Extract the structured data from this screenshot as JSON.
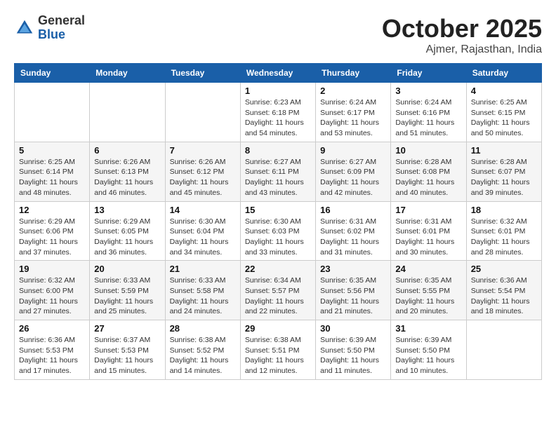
{
  "header": {
    "logo_general": "General",
    "logo_blue": "Blue",
    "month_title": "October 2025",
    "location": "Ajmer, Rajasthan, India"
  },
  "weekdays": [
    "Sunday",
    "Monday",
    "Tuesday",
    "Wednesday",
    "Thursday",
    "Friday",
    "Saturday"
  ],
  "weeks": [
    [
      {
        "day": "",
        "info": ""
      },
      {
        "day": "",
        "info": ""
      },
      {
        "day": "",
        "info": ""
      },
      {
        "day": "1",
        "info": "Sunrise: 6:23 AM\nSunset: 6:18 PM\nDaylight: 11 hours\nand 54 minutes."
      },
      {
        "day": "2",
        "info": "Sunrise: 6:24 AM\nSunset: 6:17 PM\nDaylight: 11 hours\nand 53 minutes."
      },
      {
        "day": "3",
        "info": "Sunrise: 6:24 AM\nSunset: 6:16 PM\nDaylight: 11 hours\nand 51 minutes."
      },
      {
        "day": "4",
        "info": "Sunrise: 6:25 AM\nSunset: 6:15 PM\nDaylight: 11 hours\nand 50 minutes."
      }
    ],
    [
      {
        "day": "5",
        "info": "Sunrise: 6:25 AM\nSunset: 6:14 PM\nDaylight: 11 hours\nand 48 minutes."
      },
      {
        "day": "6",
        "info": "Sunrise: 6:26 AM\nSunset: 6:13 PM\nDaylight: 11 hours\nand 46 minutes."
      },
      {
        "day": "7",
        "info": "Sunrise: 6:26 AM\nSunset: 6:12 PM\nDaylight: 11 hours\nand 45 minutes."
      },
      {
        "day": "8",
        "info": "Sunrise: 6:27 AM\nSunset: 6:11 PM\nDaylight: 11 hours\nand 43 minutes."
      },
      {
        "day": "9",
        "info": "Sunrise: 6:27 AM\nSunset: 6:09 PM\nDaylight: 11 hours\nand 42 minutes."
      },
      {
        "day": "10",
        "info": "Sunrise: 6:28 AM\nSunset: 6:08 PM\nDaylight: 11 hours\nand 40 minutes."
      },
      {
        "day": "11",
        "info": "Sunrise: 6:28 AM\nSunset: 6:07 PM\nDaylight: 11 hours\nand 39 minutes."
      }
    ],
    [
      {
        "day": "12",
        "info": "Sunrise: 6:29 AM\nSunset: 6:06 PM\nDaylight: 11 hours\nand 37 minutes."
      },
      {
        "day": "13",
        "info": "Sunrise: 6:29 AM\nSunset: 6:05 PM\nDaylight: 11 hours\nand 36 minutes."
      },
      {
        "day": "14",
        "info": "Sunrise: 6:30 AM\nSunset: 6:04 PM\nDaylight: 11 hours\nand 34 minutes."
      },
      {
        "day": "15",
        "info": "Sunrise: 6:30 AM\nSunset: 6:03 PM\nDaylight: 11 hours\nand 33 minutes."
      },
      {
        "day": "16",
        "info": "Sunrise: 6:31 AM\nSunset: 6:02 PM\nDaylight: 11 hours\nand 31 minutes."
      },
      {
        "day": "17",
        "info": "Sunrise: 6:31 AM\nSunset: 6:01 PM\nDaylight: 11 hours\nand 30 minutes."
      },
      {
        "day": "18",
        "info": "Sunrise: 6:32 AM\nSunset: 6:01 PM\nDaylight: 11 hours\nand 28 minutes."
      }
    ],
    [
      {
        "day": "19",
        "info": "Sunrise: 6:32 AM\nSunset: 6:00 PM\nDaylight: 11 hours\nand 27 minutes."
      },
      {
        "day": "20",
        "info": "Sunrise: 6:33 AM\nSunset: 5:59 PM\nDaylight: 11 hours\nand 25 minutes."
      },
      {
        "day": "21",
        "info": "Sunrise: 6:33 AM\nSunset: 5:58 PM\nDaylight: 11 hours\nand 24 minutes."
      },
      {
        "day": "22",
        "info": "Sunrise: 6:34 AM\nSunset: 5:57 PM\nDaylight: 11 hours\nand 22 minutes."
      },
      {
        "day": "23",
        "info": "Sunrise: 6:35 AM\nSunset: 5:56 PM\nDaylight: 11 hours\nand 21 minutes."
      },
      {
        "day": "24",
        "info": "Sunrise: 6:35 AM\nSunset: 5:55 PM\nDaylight: 11 hours\nand 20 minutes."
      },
      {
        "day": "25",
        "info": "Sunrise: 6:36 AM\nSunset: 5:54 PM\nDaylight: 11 hours\nand 18 minutes."
      }
    ],
    [
      {
        "day": "26",
        "info": "Sunrise: 6:36 AM\nSunset: 5:53 PM\nDaylight: 11 hours\nand 17 minutes."
      },
      {
        "day": "27",
        "info": "Sunrise: 6:37 AM\nSunset: 5:53 PM\nDaylight: 11 hours\nand 15 minutes."
      },
      {
        "day": "28",
        "info": "Sunrise: 6:38 AM\nSunset: 5:52 PM\nDaylight: 11 hours\nand 14 minutes."
      },
      {
        "day": "29",
        "info": "Sunrise: 6:38 AM\nSunset: 5:51 PM\nDaylight: 11 hours\nand 12 minutes."
      },
      {
        "day": "30",
        "info": "Sunrise: 6:39 AM\nSunset: 5:50 PM\nDaylight: 11 hours\nand 11 minutes."
      },
      {
        "day": "31",
        "info": "Sunrise: 6:39 AM\nSunset: 5:50 PM\nDaylight: 11 hours\nand 10 minutes."
      },
      {
        "day": "",
        "info": ""
      }
    ]
  ]
}
